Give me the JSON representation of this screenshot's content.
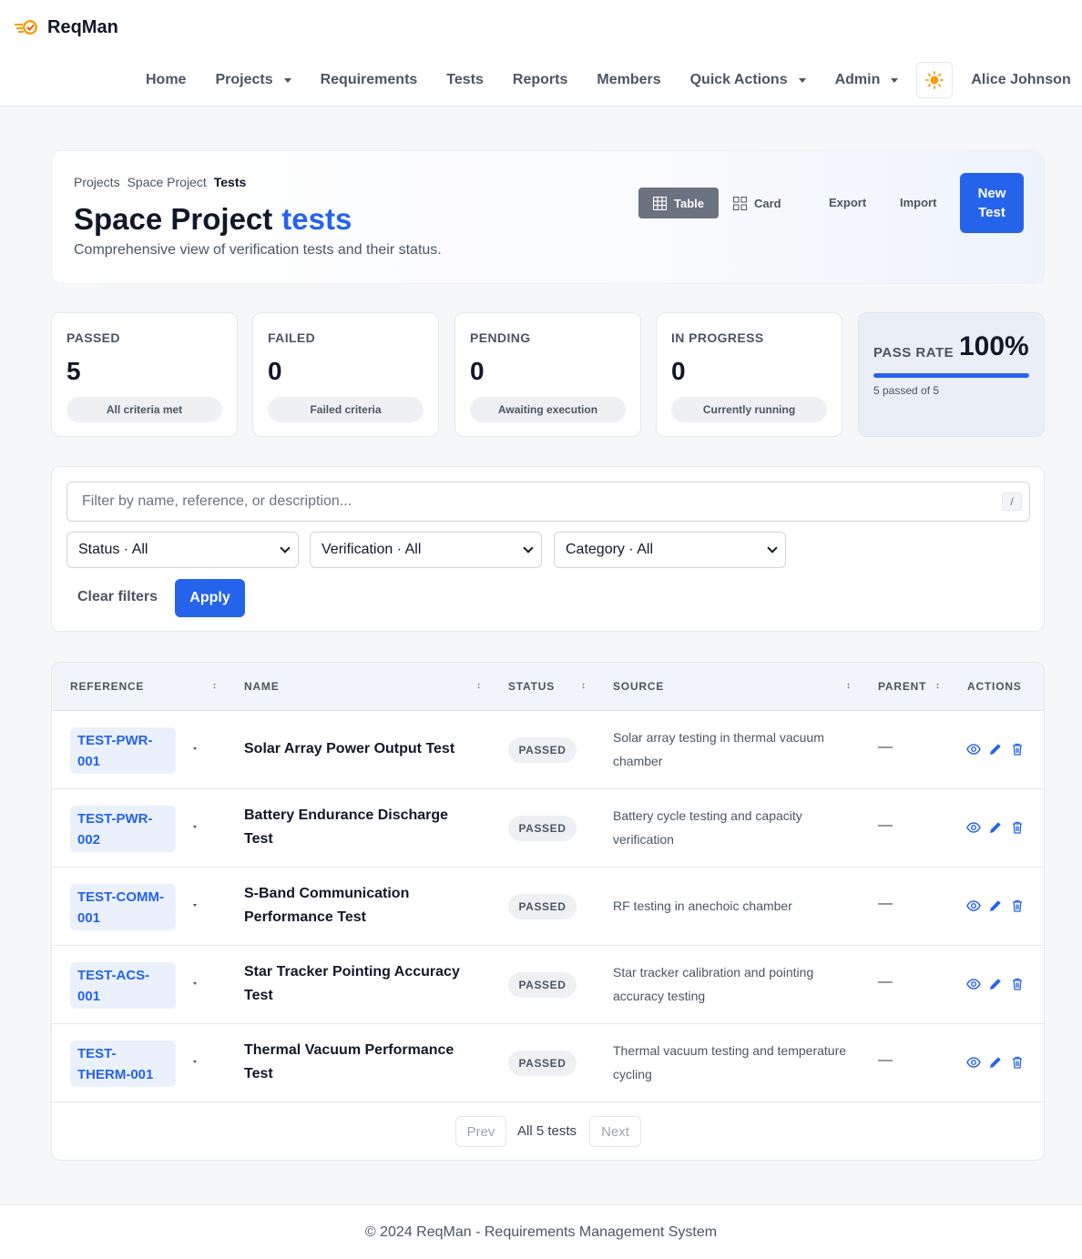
{
  "app": {
    "name": "ReqMan"
  },
  "nav": {
    "home": "Home",
    "projects": "Projects",
    "requirements": "Requirements",
    "tests": "Tests",
    "reports": "Reports",
    "members": "Members",
    "quick_actions": "Quick Actions",
    "admin": "Admin",
    "user": "Alice Johnson",
    "theme_icon": "sun-icon"
  },
  "breadcrumb": {
    "projects": "Projects",
    "project": "Space Project",
    "current": "Tests"
  },
  "page": {
    "title": "Space Project",
    "title_accent": "tests",
    "subtitle": "Comprehensive view of verification tests and their status."
  },
  "toolbar": {
    "table": "Table",
    "card": "Card",
    "export": "Export",
    "import": "Import",
    "new_test": "New Test"
  },
  "stats": {
    "passed": {
      "label": "PASSED",
      "value": "5",
      "caption": "All criteria met"
    },
    "failed": {
      "label": "FAILED",
      "value": "0",
      "caption": "Failed criteria"
    },
    "pending": {
      "label": "PENDING",
      "value": "0",
      "caption": "Awaiting execution"
    },
    "in_progress": {
      "label": "IN PROGRESS",
      "value": "0",
      "caption": "Currently running"
    },
    "pass_rate": {
      "label": "PASS RATE",
      "value": "100%",
      "fraction": 1.0,
      "caption": "5 passed of 5"
    }
  },
  "filters": {
    "search_placeholder": "Filter by name, reference, or description...",
    "search_shortcut": "/",
    "status": "Status · All",
    "verification": "Verification · All",
    "category": "Category · All",
    "clear": "Clear filters",
    "apply": "Apply"
  },
  "table": {
    "headers": {
      "reference": "REFERENCE",
      "name": "NAME",
      "status": "STATUS",
      "source": "SOURCE",
      "parent": "PARENT",
      "actions": "ACTIONS"
    },
    "sort_icon": "↕",
    "rows": [
      {
        "ref": "TEST-PWR-001",
        "name": "Solar Array Power Output Test",
        "status": "PASSED",
        "source": "Solar array testing in thermal vacuum chamber",
        "parent": "—"
      },
      {
        "ref": "TEST-PWR-002",
        "name": "Battery Endurance Discharge Test",
        "status": "PASSED",
        "source": "Battery cycle testing and capacity verification",
        "parent": "—"
      },
      {
        "ref": "TEST-COMM-001",
        "name": "S-Band Communication Performance Test",
        "status": "PASSED",
        "source": "RF testing in anechoic chamber",
        "parent": "—"
      },
      {
        "ref": "TEST-ACS-001",
        "name": "Star Tracker Pointing Accuracy Test",
        "status": "PASSED",
        "source": "Star tracker calibration and pointing accuracy testing",
        "parent": "—"
      },
      {
        "ref": "TEST-THERM-001",
        "name": "Thermal Vacuum Performance Test",
        "status": "PASSED",
        "source": "Thermal vacuum testing and temperature cycling",
        "parent": "—"
      }
    ]
  },
  "pagination": {
    "prev": "Prev",
    "info": "All 5 tests",
    "next": "Next"
  },
  "footer": {
    "text": "© 2024 ReqMan - Requirements Management System"
  },
  "colors": {
    "accent": "#2563eb",
    "muted": "#4b5563"
  }
}
